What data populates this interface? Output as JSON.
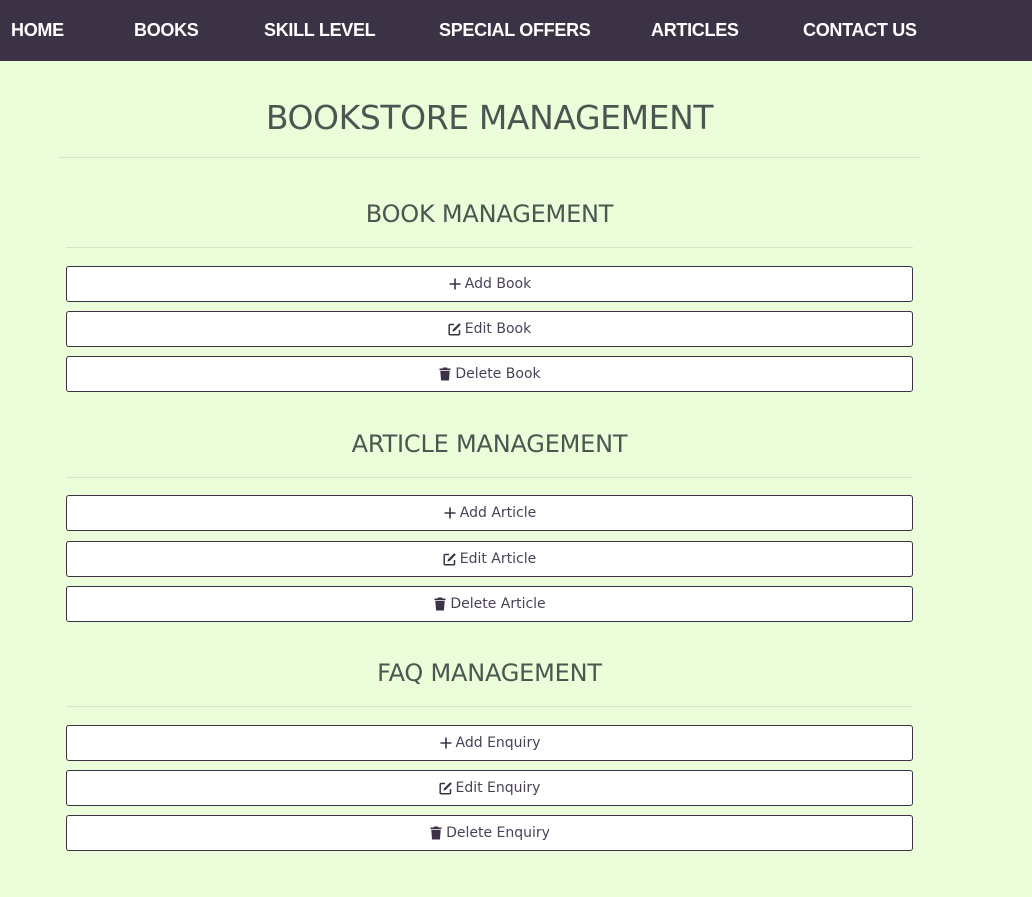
{
  "nav": {
    "items": [
      {
        "label": "HOME"
      },
      {
        "label": "BOOKS"
      },
      {
        "label": "SKILL LEVEL"
      },
      {
        "label": "SPECIAL OFFERS"
      },
      {
        "label": "ARTICLES"
      },
      {
        "label": "CONTACT US"
      }
    ]
  },
  "page": {
    "title": "BOOKSTORE MANAGEMENT"
  },
  "sections": [
    {
      "title": "BOOK MANAGEMENT",
      "buttons": [
        {
          "label": "Add Book",
          "icon": "plus-icon"
        },
        {
          "label": "Edit Book",
          "icon": "edit-icon"
        },
        {
          "label": "Delete Book",
          "icon": "trash-icon"
        }
      ]
    },
    {
      "title": "ARTICLE MANAGEMENT",
      "buttons": [
        {
          "label": "Add Article",
          "icon": "plus-icon"
        },
        {
          "label": "Edit Article",
          "icon": "edit-icon"
        },
        {
          "label": "Delete Article",
          "icon": "trash-icon"
        }
      ]
    },
    {
      "title": "FAQ MANAGEMENT",
      "buttons": [
        {
          "label": "Add Enquiry",
          "icon": "plus-icon"
        },
        {
          "label": "Edit Enquiry",
          "icon": "edit-icon"
        },
        {
          "label": "Delete Enquiry",
          "icon": "trash-icon"
        }
      ]
    }
  ],
  "colors": {
    "navbar_bg": "#3c3245",
    "page_bg": "#ebfdd9",
    "heading_text": "#4d5550",
    "button_border": "#3c3245",
    "button_bg": "#ffffff"
  }
}
